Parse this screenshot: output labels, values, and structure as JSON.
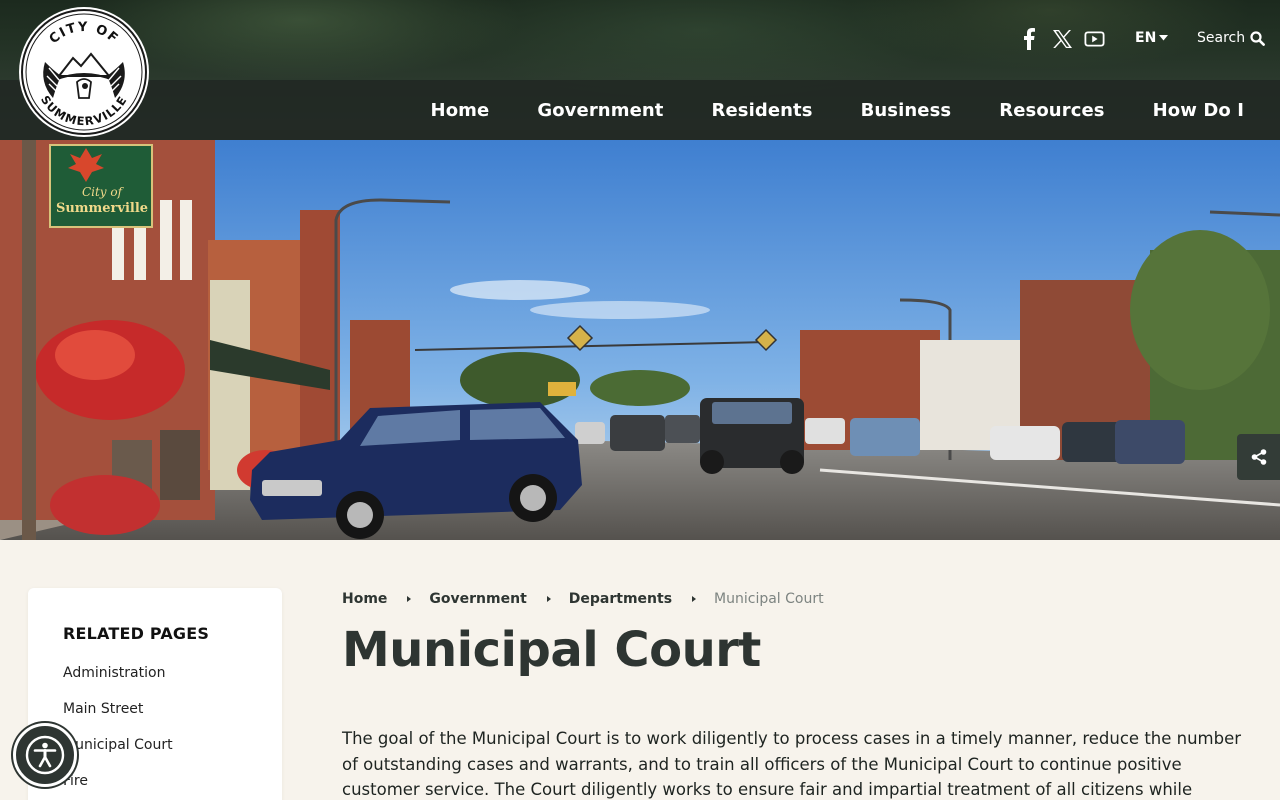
{
  "brand": {
    "logo_top_text": "CITY OF",
    "logo_bottom_text": "SUMMERVILLE",
    "hero_sign_text_1": "City of",
    "hero_sign_text_2": "Summerville"
  },
  "header": {
    "social": [
      {
        "name": "facebook-icon"
      },
      {
        "name": "x-twitter-icon"
      },
      {
        "name": "youtube-icon"
      }
    ],
    "language": "EN",
    "search_label": "Search"
  },
  "nav": {
    "items": [
      {
        "label": "Home"
      },
      {
        "label": "Government"
      },
      {
        "label": "Residents"
      },
      {
        "label": "Business"
      },
      {
        "label": "Resources"
      },
      {
        "label": "How Do I"
      }
    ]
  },
  "sidebar": {
    "heading": "RELATED PAGES",
    "items": [
      {
        "label": "Administration"
      },
      {
        "label": "Main Street"
      },
      {
        "label": "Municipal Court"
      },
      {
        "label": "Fire"
      }
    ]
  },
  "breadcrumb": {
    "items": [
      {
        "label": "Home"
      },
      {
        "label": "Government"
      },
      {
        "label": "Departments"
      }
    ],
    "current": "Municipal Court"
  },
  "main": {
    "title": "Municipal Court",
    "intro": "The goal of the Municipal Court is to work diligently to process cases in a timely manner, reduce the number of outstanding cases and warrants, and to train all officers of the Municipal Court to continue positive customer service. The Court diligently works to ensure fair and impartial treatment of all citizens while maintaining a working"
  },
  "colors": {
    "page_background": "#f7f3ec",
    "text_dark": "#2e3532",
    "nav_bar": "#202622",
    "breadcrumb_current": "#7d8481"
  }
}
